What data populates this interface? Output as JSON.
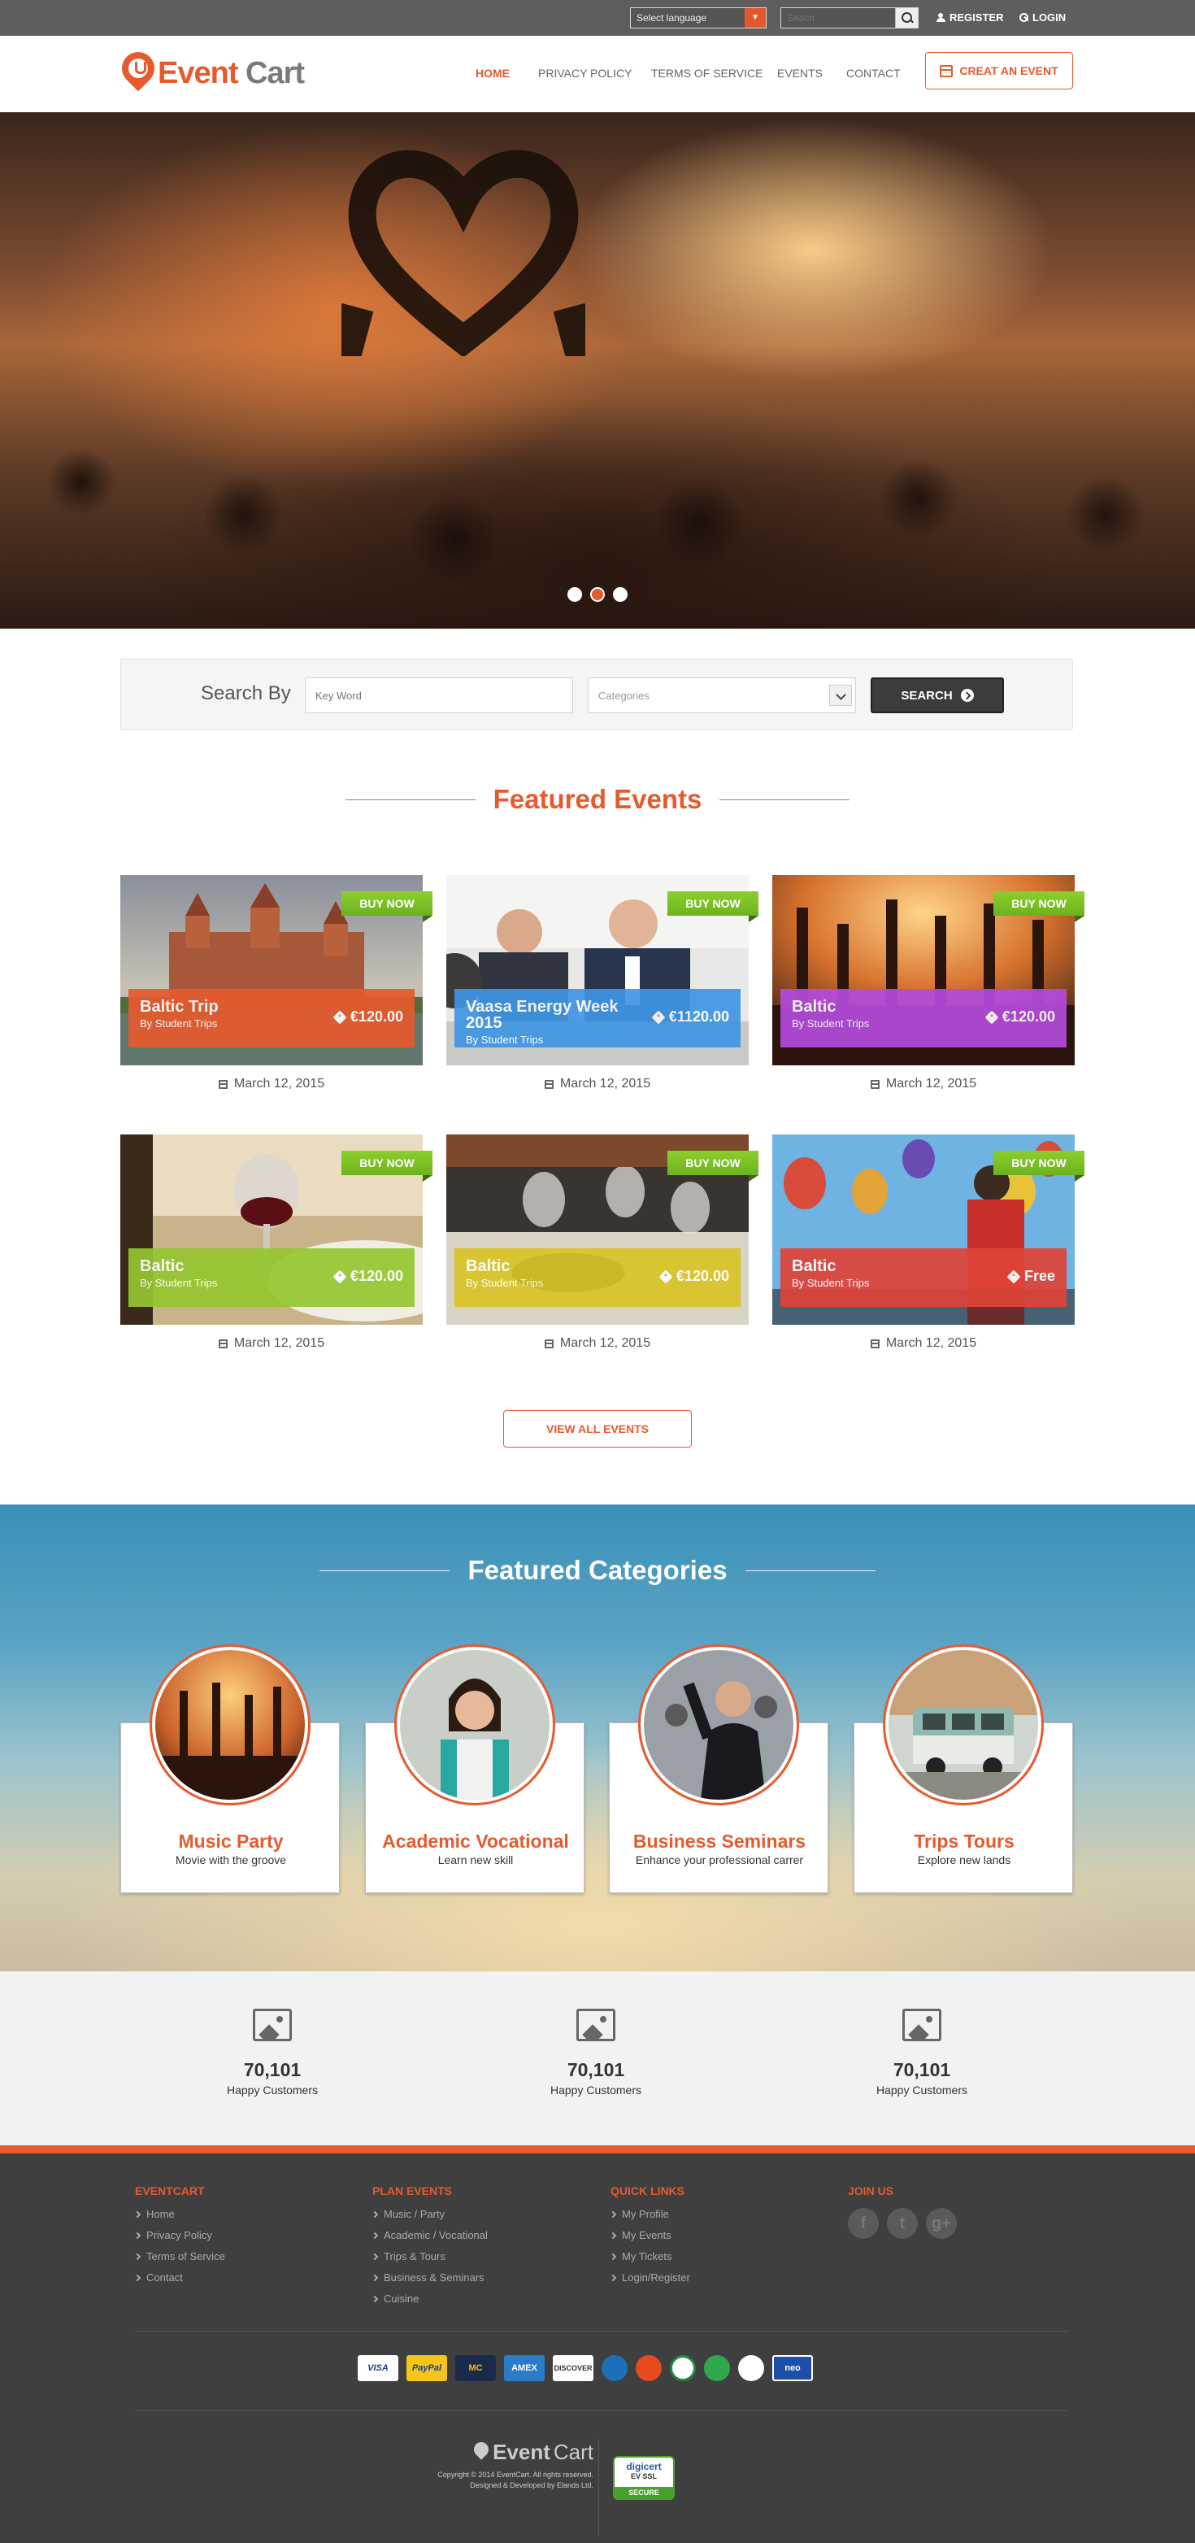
{
  "topbar": {
    "language_label": "Select language",
    "search_placeholder": "Seach",
    "register": "REGISTER",
    "login": "LOGIN"
  },
  "header": {
    "logo_part1": "Event",
    "logo_part2": "Cart",
    "nav": [
      "HOME",
      "PRIVACY POLICY",
      "TERMS OF SERVICE",
      "EVENTS",
      "CONTACT"
    ],
    "create_button": "CREAT AN EVENT"
  },
  "search": {
    "label": "Search By",
    "keyword_placeholder": "Key Word",
    "categories_value": "Categories",
    "button": "SEARCH"
  },
  "featured_events": {
    "title": "Featured Events",
    "buy_label": "BUY NOW",
    "cards": [
      {
        "title": "Baltic Trip",
        "organizer": "By Student Trips",
        "price": "€120.00",
        "date": "March 12, 2015",
        "color": "#e65a2e"
      },
      {
        "title": "Vaasa Energy Week 2015",
        "organizer": "By Student Trips",
        "price": "€1120.00",
        "date": "March 12, 2015",
        "color": "#3f95e4"
      },
      {
        "title": "Baltic",
        "organizer": "By Student Trips",
        "price": "€120.00",
        "date": "March 12, 2015",
        "color": "#b44bdc"
      },
      {
        "title": "Baltic",
        "organizer": "By Student Trips",
        "price": "€120.00",
        "date": "March 12, 2015",
        "color": "#95c631"
      },
      {
        "title": "Baltic",
        "organizer": "By Student Trips",
        "price": "€120.00",
        "date": "March 12, 2015",
        "color": "#d9c426"
      },
      {
        "title": "Baltic",
        "organizer": "By Student Trips",
        "price": "Free",
        "date": "March 12, 2015",
        "color": "#e04338"
      }
    ],
    "view_all": "VIEW ALL EVENTS"
  },
  "featured_categories": {
    "title": "Featured Categories",
    "items": [
      {
        "name": "Music Party",
        "subtitle": "Movie with the groove"
      },
      {
        "name": "Academic Vocational",
        "subtitle": "Learn new skill"
      },
      {
        "name": "Business Seminars",
        "subtitle": "Enhance your professional carrer"
      },
      {
        "name": "Trips Tours",
        "subtitle": "Explore new lands"
      }
    ]
  },
  "stats": [
    {
      "value": "70,101",
      "label": "Happy Customers"
    },
    {
      "value": "70,101",
      "label": "Happy Customers"
    },
    {
      "value": "70,101",
      "label": "Happy Customers"
    }
  ],
  "footer": {
    "col1": {
      "title": "EVENTCART",
      "links": [
        "Home",
        "Privacy Policy",
        "Terms of Service",
        "Contact"
      ]
    },
    "col2": {
      "title": "PLAN EVENTS",
      "links": [
        "Music / Party",
        "Academic / Vocational",
        "Trips & Tours",
        "Business & Seminars",
        "Cuisine"
      ]
    },
    "col3": {
      "title": "QUICK LINKS",
      "links": [
        "My Profile",
        "My Events",
        "My Tickets",
        "Login/Register"
      ]
    },
    "col4": {
      "title": "JOIN US"
    },
    "social": [
      "f",
      "t",
      "g+"
    ],
    "payments": [
      "VISA",
      "PayPal",
      "MC",
      "AMEX",
      "DISCOVER",
      "",
      "",
      "",
      "",
      "",
      "neo"
    ],
    "logo_part1": "Event",
    "logo_part2": "Cart",
    "copyright": "Copyright © 2014 EventCart. All rights reserved.",
    "designed_by": "Designed & Developed by Elands Ltd.",
    "badge_line1": "digicert",
    "badge_line2": "EV SSL",
    "badge_line3": "SECURE"
  }
}
